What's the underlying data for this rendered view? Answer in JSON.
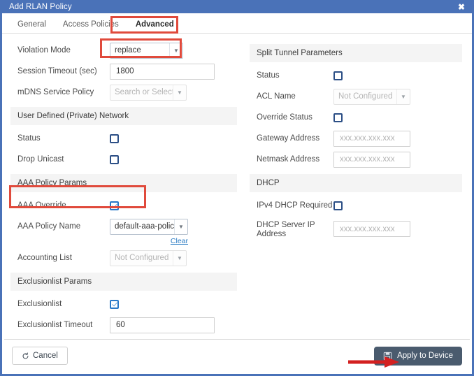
{
  "window": {
    "title": "Add RLAN Policy",
    "close_icon": "close-icon",
    "accent_color": "#4a72b8"
  },
  "tabs": [
    {
      "label": "General",
      "active": false
    },
    {
      "label": "Access Policies",
      "active": false
    },
    {
      "label": "Advanced",
      "active": true
    }
  ],
  "left_column": {
    "violation_mode": {
      "label": "Violation Mode",
      "value": "replace"
    },
    "session_timeout": {
      "label": "Session Timeout (sec)",
      "value": "1800"
    },
    "mdns_service_policy": {
      "label": "mDNS Service Policy",
      "placeholder": "Search or Select",
      "disabled": true
    },
    "udn_section": {
      "title": "User Defined (Private) Network"
    },
    "udn_status": {
      "label": "Status",
      "checked": false
    },
    "udn_drop_unicast": {
      "label": "Drop Unicast",
      "checked": false
    },
    "aaa_section": {
      "title": "AAA Policy Params"
    },
    "aaa_override": {
      "label": "AAA Override",
      "checked": true
    },
    "aaa_policy_name": {
      "label": "AAA Policy Name",
      "value": "default-aaa-policy",
      "clear_label": "Clear"
    },
    "accounting_list": {
      "label": "Accounting List",
      "placeholder": "Not Configured",
      "disabled": true
    },
    "exclusionlist_section": {
      "title": "Exclusionlist Params"
    },
    "exclusionlist": {
      "label": "Exclusionlist",
      "checked": true
    },
    "exclusionlist_timeout": {
      "label": "Exclusionlist Timeout",
      "value": "60"
    }
  },
  "right_column": {
    "split_tunnel_section": {
      "title": "Split Tunnel Parameters"
    },
    "split_status": {
      "label": "Status",
      "checked": false
    },
    "acl_name": {
      "label": "ACL Name",
      "placeholder": "Not Configured",
      "disabled": true
    },
    "override_status": {
      "label": "Override Status",
      "checked": false
    },
    "gateway_address": {
      "label": "Gateway Address",
      "placeholder": "xxx.xxx.xxx.xxx"
    },
    "netmask_address": {
      "label": "Netmask Address",
      "placeholder": "xxx.xxx.xxx.xxx"
    },
    "dhcp_section": {
      "title": "DHCP"
    },
    "ipv4_dhcp_required": {
      "label": "IPv4 DHCP Required",
      "checked": false
    },
    "dhcp_server_ip": {
      "label": "DHCP Server IP Address",
      "placeholder": "xxx.xxx.xxx.xxx"
    }
  },
  "footer": {
    "cancel_label": "Cancel",
    "cancel_icon": "undo-icon",
    "apply_label": "Apply to Device",
    "apply_icon": "save-disk-icon"
  },
  "annotations": {
    "color": "#e04a3c",
    "highlight_tab": "Advanced",
    "highlight_violation_mode": "replace",
    "highlight_aaa_override": "AAA Override",
    "arrow_target": "Apply to Device"
  }
}
